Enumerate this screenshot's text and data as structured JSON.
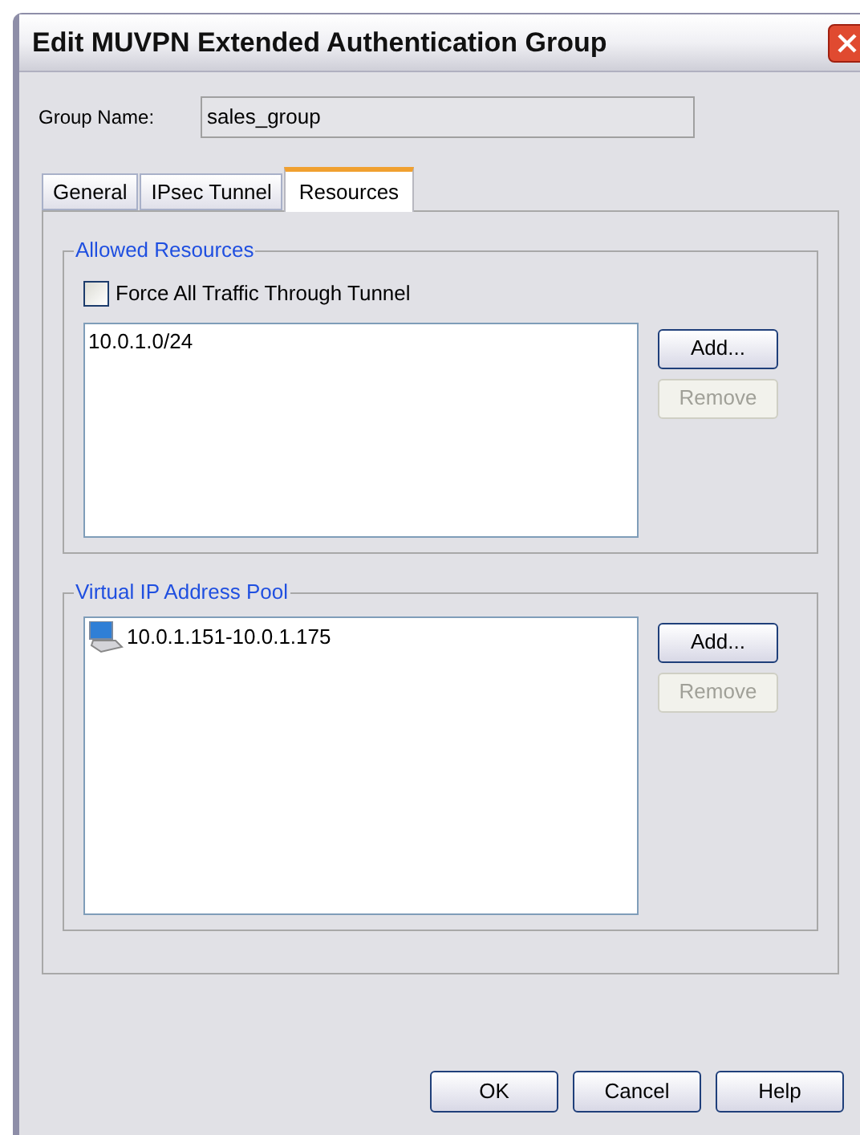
{
  "window": {
    "title": "Edit MUVPN Extended Authentication Group"
  },
  "group_name": {
    "label": "Group Name:",
    "value": "sales_group"
  },
  "tabs": [
    {
      "label": "General",
      "selected": false
    },
    {
      "label": "IPsec Tunnel",
      "selected": false
    },
    {
      "label": "Resources",
      "selected": true
    }
  ],
  "sections": [
    {
      "title": "Allowed Resources",
      "checkbox": {
        "label": "Force All Traffic Through Tunnel",
        "checked": false
      },
      "items": [
        {
          "text": "10.0.1.0/24",
          "kind": "plain"
        }
      ],
      "buttons": [
        {
          "label": "Add...",
          "disabled": false
        },
        {
          "label": "Remove",
          "disabled": true
        }
      ]
    },
    {
      "title": "Virtual IP Address Pool",
      "items": [
        {
          "text": "10.0.1.151-10.0.1.175",
          "kind": "computer"
        }
      ],
      "buttons": [
        {
          "label": "Add...",
          "disabled": false
        },
        {
          "label": "Remove",
          "disabled": true
        }
      ]
    }
  ],
  "buttons": [
    "OK",
    "Cancel",
    "Help"
  ]
}
